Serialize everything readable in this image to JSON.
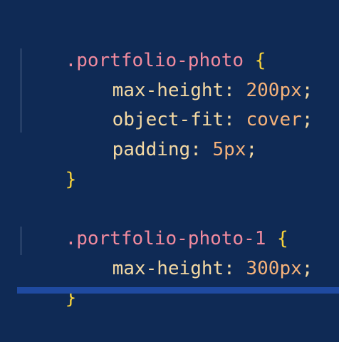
{
  "code": {
    "block1": {
      "selector": ".portfolio-photo",
      "open_brace": "{",
      "close_brace": "}",
      "declarations": [
        {
          "property": "max-height",
          "value": "200px"
        },
        {
          "property": "object-fit",
          "value": "cover"
        },
        {
          "property": "padding",
          "value": "5px"
        }
      ]
    },
    "block2": {
      "selector": ".portfolio-photo-1",
      "open_brace": "{",
      "close_brace": "}",
      "declarations": [
        {
          "property": "max-height",
          "value": "300px"
        }
      ]
    },
    "punct": {
      "colon": ":",
      "semicolon": ";"
    }
  }
}
